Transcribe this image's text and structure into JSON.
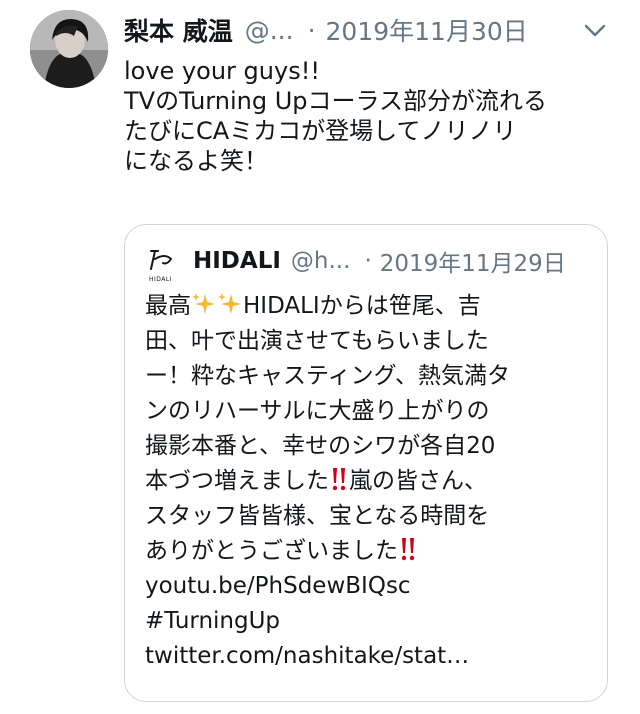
{
  "tweet": {
    "author_name": "梨本 威温",
    "author_handle": "@...",
    "separator": "·",
    "date": "2019年11月30日",
    "lines": [
      "love your guys!!",
      "TVのTurning Upコーラス部分が流れる",
      "たびにCAミカコが登場してノリノリ",
      "になるよ笑！"
    ]
  },
  "quote": {
    "author_name": "HIDALI",
    "author_handle": "@h...",
    "separator": "·",
    "date": "2019年11月29日",
    "logo_text": "HIDALI",
    "line1_a": "最高",
    "line1_b": "HIDALIからは笹尾、吉",
    "line2": "田、叶で出演させてもらいました",
    "line3": "ー！粋なキャスティング、熱気満タ",
    "line4": "ンのリハーサルに大盛り上がりの",
    "line5": "撮影本番と、幸せのシワが各自20",
    "line6_a": "本づつ増えました",
    "line6_b": "嵐の皆さん、",
    "line7": "スタッフ皆皆様、宝となる時間を",
    "line8": "ありがとうございました",
    "link1": "youtu.be/PhSdewBIQsc",
    "hashtag": "#TurningUp",
    "link2": "twitter.com/nashitake/stat…"
  },
  "icons": {
    "more": "chevron-down-icon",
    "sparkle": "sparkles-icon",
    "double_exclamation": "double-exclamation-icon"
  },
  "colors": {
    "text": "#14171a",
    "secondary": "#657786",
    "border": "#ccd6dd",
    "sparkle": "#f5b82e",
    "exclamation": "#d0021b"
  }
}
